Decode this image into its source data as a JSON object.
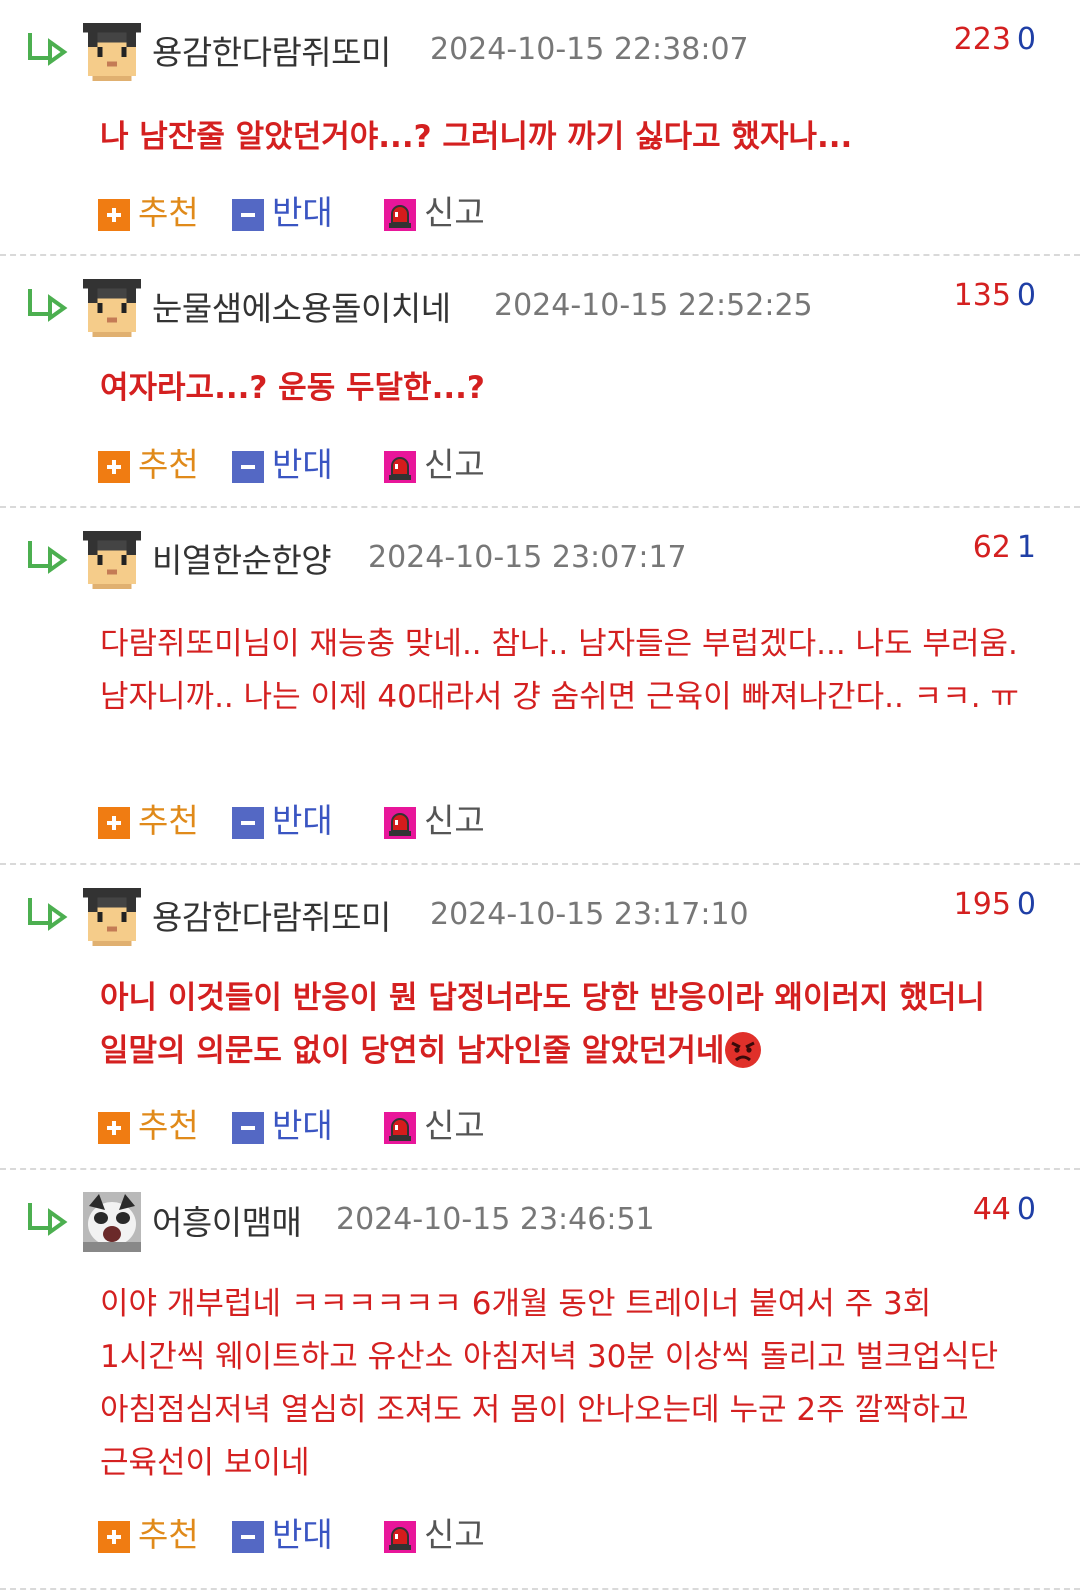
{
  "actions": {
    "recommend": "추천",
    "oppose": "반대",
    "report": "신고"
  },
  "comments": [
    {
      "nickname": "용감한다람쥐또미",
      "date": "2024-10-15 22:38:07",
      "upvotes": "223",
      "downvotes": "0",
      "text": "나 남잔줄 알았던거야...? 그러니까 까기 싫다고 했자나...",
      "avatar_icon": "pixel-avatar-icon"
    },
    {
      "nickname": "눈물샘에소용돌이치네",
      "date": "2024-10-15 22:52:25",
      "upvotes": "135",
      "downvotes": "0",
      "text": "여자라고...? 운동 두달한...?",
      "avatar_icon": "pixel-avatar-icon"
    },
    {
      "nickname": "비열한순한양",
      "date": "2024-10-15 23:07:17",
      "upvotes": "62",
      "downvotes": "1",
      "text": "다람쥐또미님이 재능충 맞네.. 참나.. 남자들은 부럽겠다... 나도 부러움. 남자니까.. 나는 이제 40대라서 걍 숨쉬면 근육이 빠져나간다.. ㅋㅋ. ㅠ",
      "avatar_icon": "pixel-avatar-icon"
    },
    {
      "nickname": "용감한다람쥐또미",
      "date": "2024-10-15 23:17:10",
      "upvotes": "195",
      "downvotes": "0",
      "text": "아니 이것들이 반응이 뭔 답정너라도 당한 반응이라 왜이러지 했더니 일말의 의문도 없이 당연히 남자인줄 알았던거네",
      "emoji": "angry-face-icon",
      "avatar_icon": "pixel-avatar-icon"
    },
    {
      "nickname": "어흥이맴매",
      "date": "2024-10-15 23:46:51",
      "upvotes": "44",
      "downvotes": "0",
      "text": "이야 개부럽네 ㅋㅋㅋㅋㅋㅋ 6개월 동안 트레이너 붙여서 주 3회 1시간씩 웨이트하고 유산소 아침저녁 30분 이상씩 돌리고 벌크업식단 아침점심저녁 열심히 조져도 저 몸이 안나오는데 누군 2주 깔짝하고 근육선이 보이네",
      "avatar_icon": "cat-photo-avatar"
    }
  ]
}
